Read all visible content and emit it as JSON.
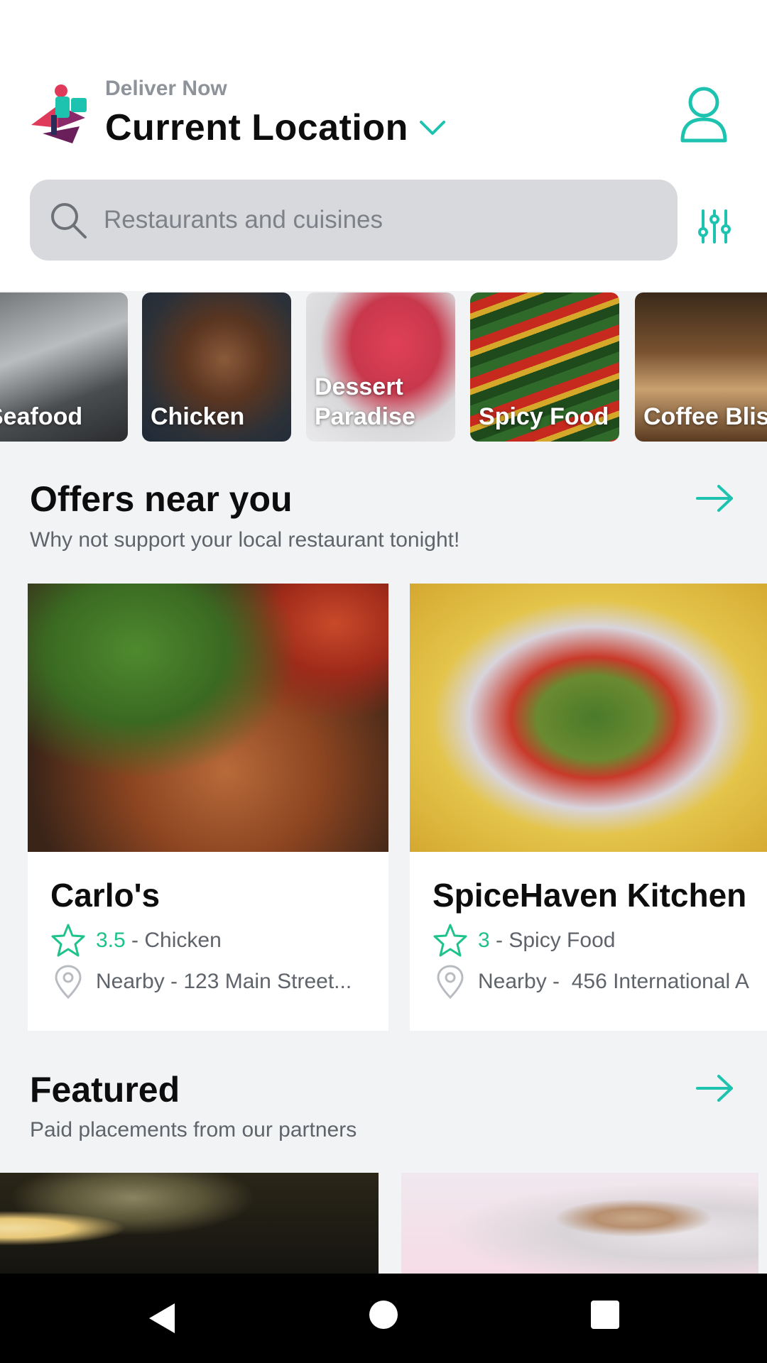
{
  "header": {
    "deliver_label": "Deliver Now",
    "location": "Current Location"
  },
  "search": {
    "placeholder": "Restaurants and cuisines"
  },
  "categories": [
    {
      "label": "Seafood"
    },
    {
      "label": "Chicken"
    },
    {
      "label": "Dessert\nParadise"
    },
    {
      "label": "Spicy Food"
    },
    {
      "label": "Coffee Bliss"
    }
  ],
  "offers": {
    "title": "Offers near you",
    "subtitle": "Why not support your local restaurant tonight!",
    "cards": [
      {
        "name": "Carlo's",
        "rating": "3.5",
        "separator": " - ",
        "category": "Chicken",
        "address": "Nearby - 123 Main Street..."
      },
      {
        "name": "SpiceHaven Kitchen",
        "rating": "3",
        "separator": " - ",
        "category": "Spicy Food",
        "address": "Nearby -  456 International A"
      }
    ]
  },
  "featured": {
    "title": "Featured",
    "subtitle": "Paid placements from our partners"
  },
  "colors": {
    "accent": "#1ec3b0",
    "rating_green": "#1ec38b",
    "background": "#f2f3f5"
  },
  "icons": [
    "logo-icon",
    "chevron-down-icon",
    "profile-icon",
    "search-icon",
    "filter-icon",
    "arrow-right-icon",
    "star-icon",
    "location-pin-icon",
    "back-icon",
    "home-icon",
    "recents-icon"
  ]
}
